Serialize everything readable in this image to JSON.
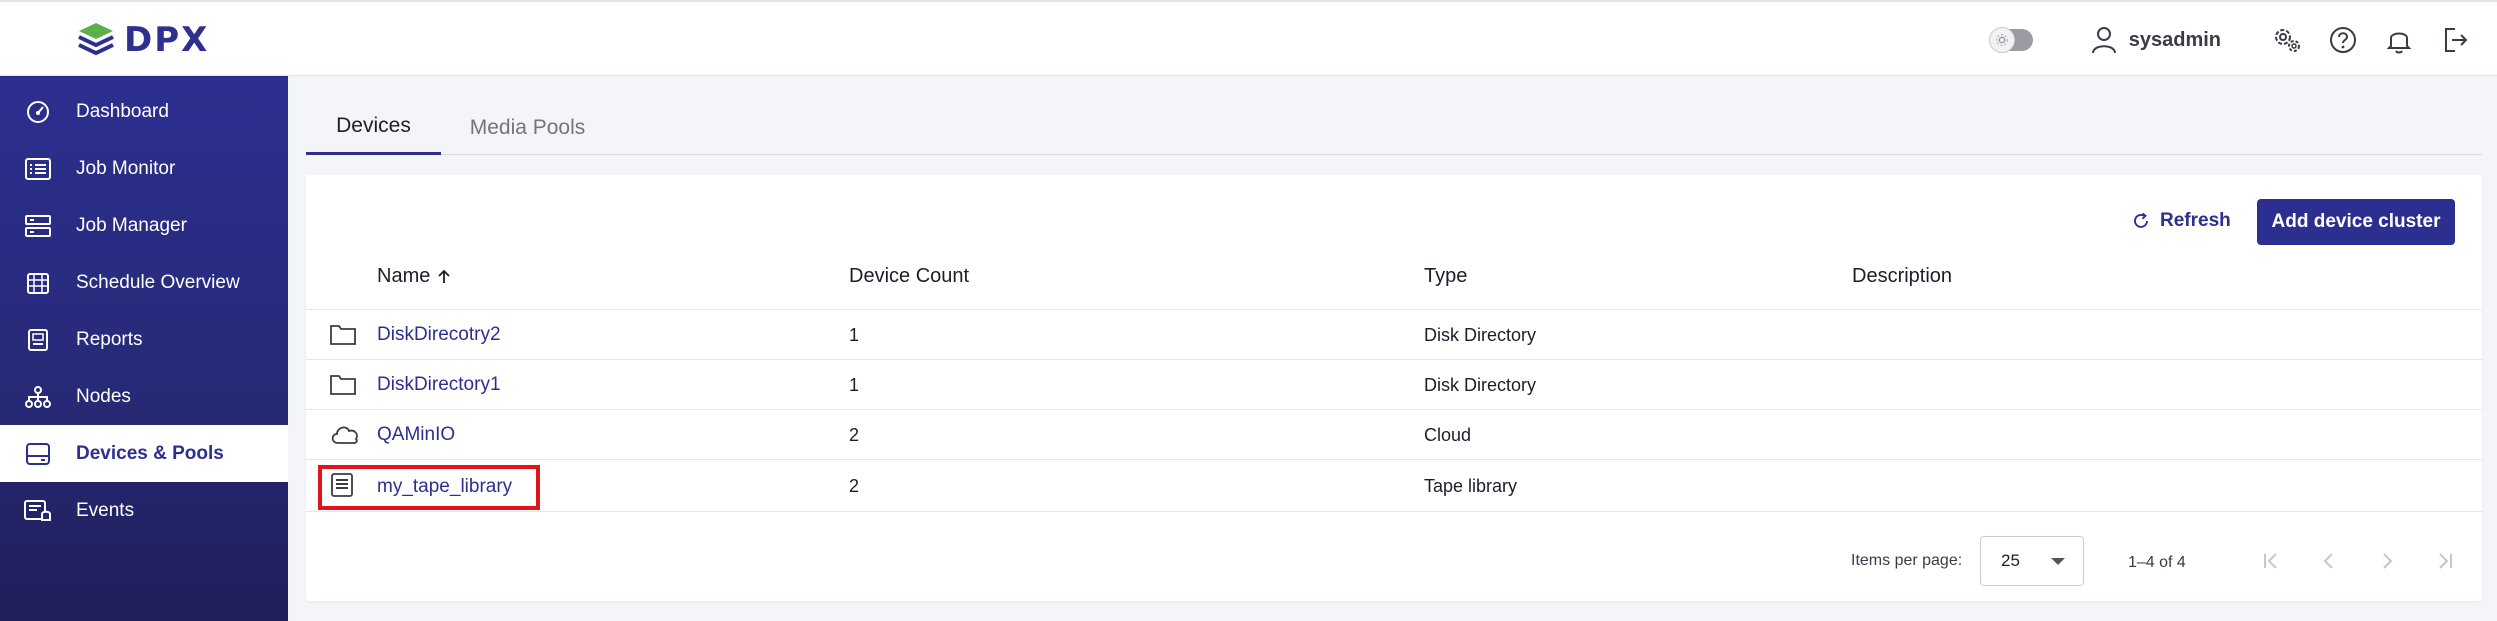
{
  "brand": {
    "name": "DPX",
    "color": "#2c2f8f"
  },
  "header": {
    "username": "sysadmin",
    "icons": [
      "theme-toggle",
      "user-icon",
      "settings-icon",
      "help-icon",
      "bell-icon",
      "logout-icon"
    ]
  },
  "sidebar": {
    "items": [
      {
        "label": "Dashboard",
        "icon": "dashboard-icon"
      },
      {
        "label": "Job Monitor",
        "icon": "job-monitor-icon"
      },
      {
        "label": "Job Manager",
        "icon": "job-manager-icon"
      },
      {
        "label": "Schedule Overview",
        "icon": "calendar-icon"
      },
      {
        "label": "Reports",
        "icon": "reports-icon"
      },
      {
        "label": "Nodes",
        "icon": "nodes-icon"
      },
      {
        "label": "Devices & Pools",
        "icon": "devices-icon",
        "active": true
      },
      {
        "label": "Events",
        "icon": "events-icon"
      }
    ]
  },
  "tabs": [
    {
      "label": "Devices",
      "active": true
    },
    {
      "label": "Media Pools",
      "active": false
    }
  ],
  "toolbar": {
    "refresh_label": "Refresh",
    "add_label": "Add device cluster"
  },
  "table": {
    "columns": {
      "name": "Name",
      "count": "Device Count",
      "type": "Type",
      "description": "Description"
    },
    "rows": [
      {
        "icon": "folder-icon",
        "name": "DiskDirecotry2",
        "count": "1",
        "type": "Disk Directory",
        "description": ""
      },
      {
        "icon": "folder-icon",
        "name": "DiskDirectory1",
        "count": "1",
        "type": "Disk Directory",
        "description": ""
      },
      {
        "icon": "cloud-icon",
        "name": "QAMinIO",
        "count": "2",
        "type": "Cloud",
        "description": ""
      },
      {
        "icon": "tape-library-icon",
        "name": "my_tape_library",
        "count": "2",
        "type": "Tape library",
        "description": "",
        "highlighted": true
      }
    ]
  },
  "pagination": {
    "items_per_page_label": "Items per page:",
    "page_size": "25",
    "range": "1–4 of 4"
  }
}
